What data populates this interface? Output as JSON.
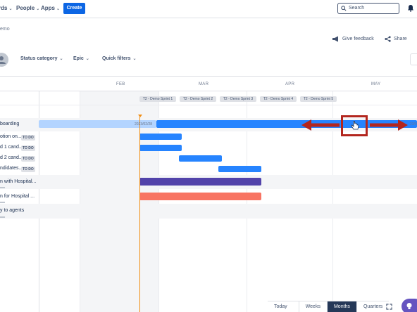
{
  "nav": {
    "items": [
      {
        "label": "rds"
      },
      {
        "label": "People"
      },
      {
        "label": "Apps"
      }
    ],
    "create_label": "Create",
    "search_placeholder": "Search"
  },
  "breadcrumb": "emo",
  "actions": {
    "feedback": "Give feedback",
    "share": "Share"
  },
  "filters": [
    "Status category",
    "Epic",
    "Quick filters"
  ],
  "timeline": {
    "months": [
      "FEB",
      "MAR",
      "APR",
      "MAY"
    ],
    "sprints": [
      "T2 - Demo Sprint 1",
      "T2 - Demo Sprint 2",
      "T2 - Demo Sprint 3",
      "T2 - Demo Sprint 4",
      "T2 - Demo Sprint 5"
    ],
    "date_start": "2023/02/28",
    "date_end": "23/0",
    "rows": [
      {
        "label": "boarding",
        "badge": ""
      },
      {
        "label": "otion on...",
        "badge": "TO DO"
      },
      {
        "label": "d 1 cand...",
        "badge": "TO DO"
      },
      {
        "label": "d 2 cand...",
        "badge": "TO DO"
      },
      {
        "label": "ndidates...",
        "badge": "TO DO"
      },
      {
        "label": "n with Hospital...",
        "badge": ""
      },
      {
        "label": "n for Hospital ...",
        "badge": ""
      },
      {
        "label": "y to agents",
        "badge": ""
      }
    ],
    "colors": {
      "epic_blue": "#2684ff",
      "epic_light": "#b3d4ff",
      "epic_purple": "#5243aa",
      "epic_red": "#f87462",
      "today": "#f18d13",
      "annotation": "#b3261e"
    }
  },
  "view": {
    "today": "Today",
    "options": [
      "Weeks",
      "Months",
      "Quarters"
    ],
    "selected": "Months"
  }
}
